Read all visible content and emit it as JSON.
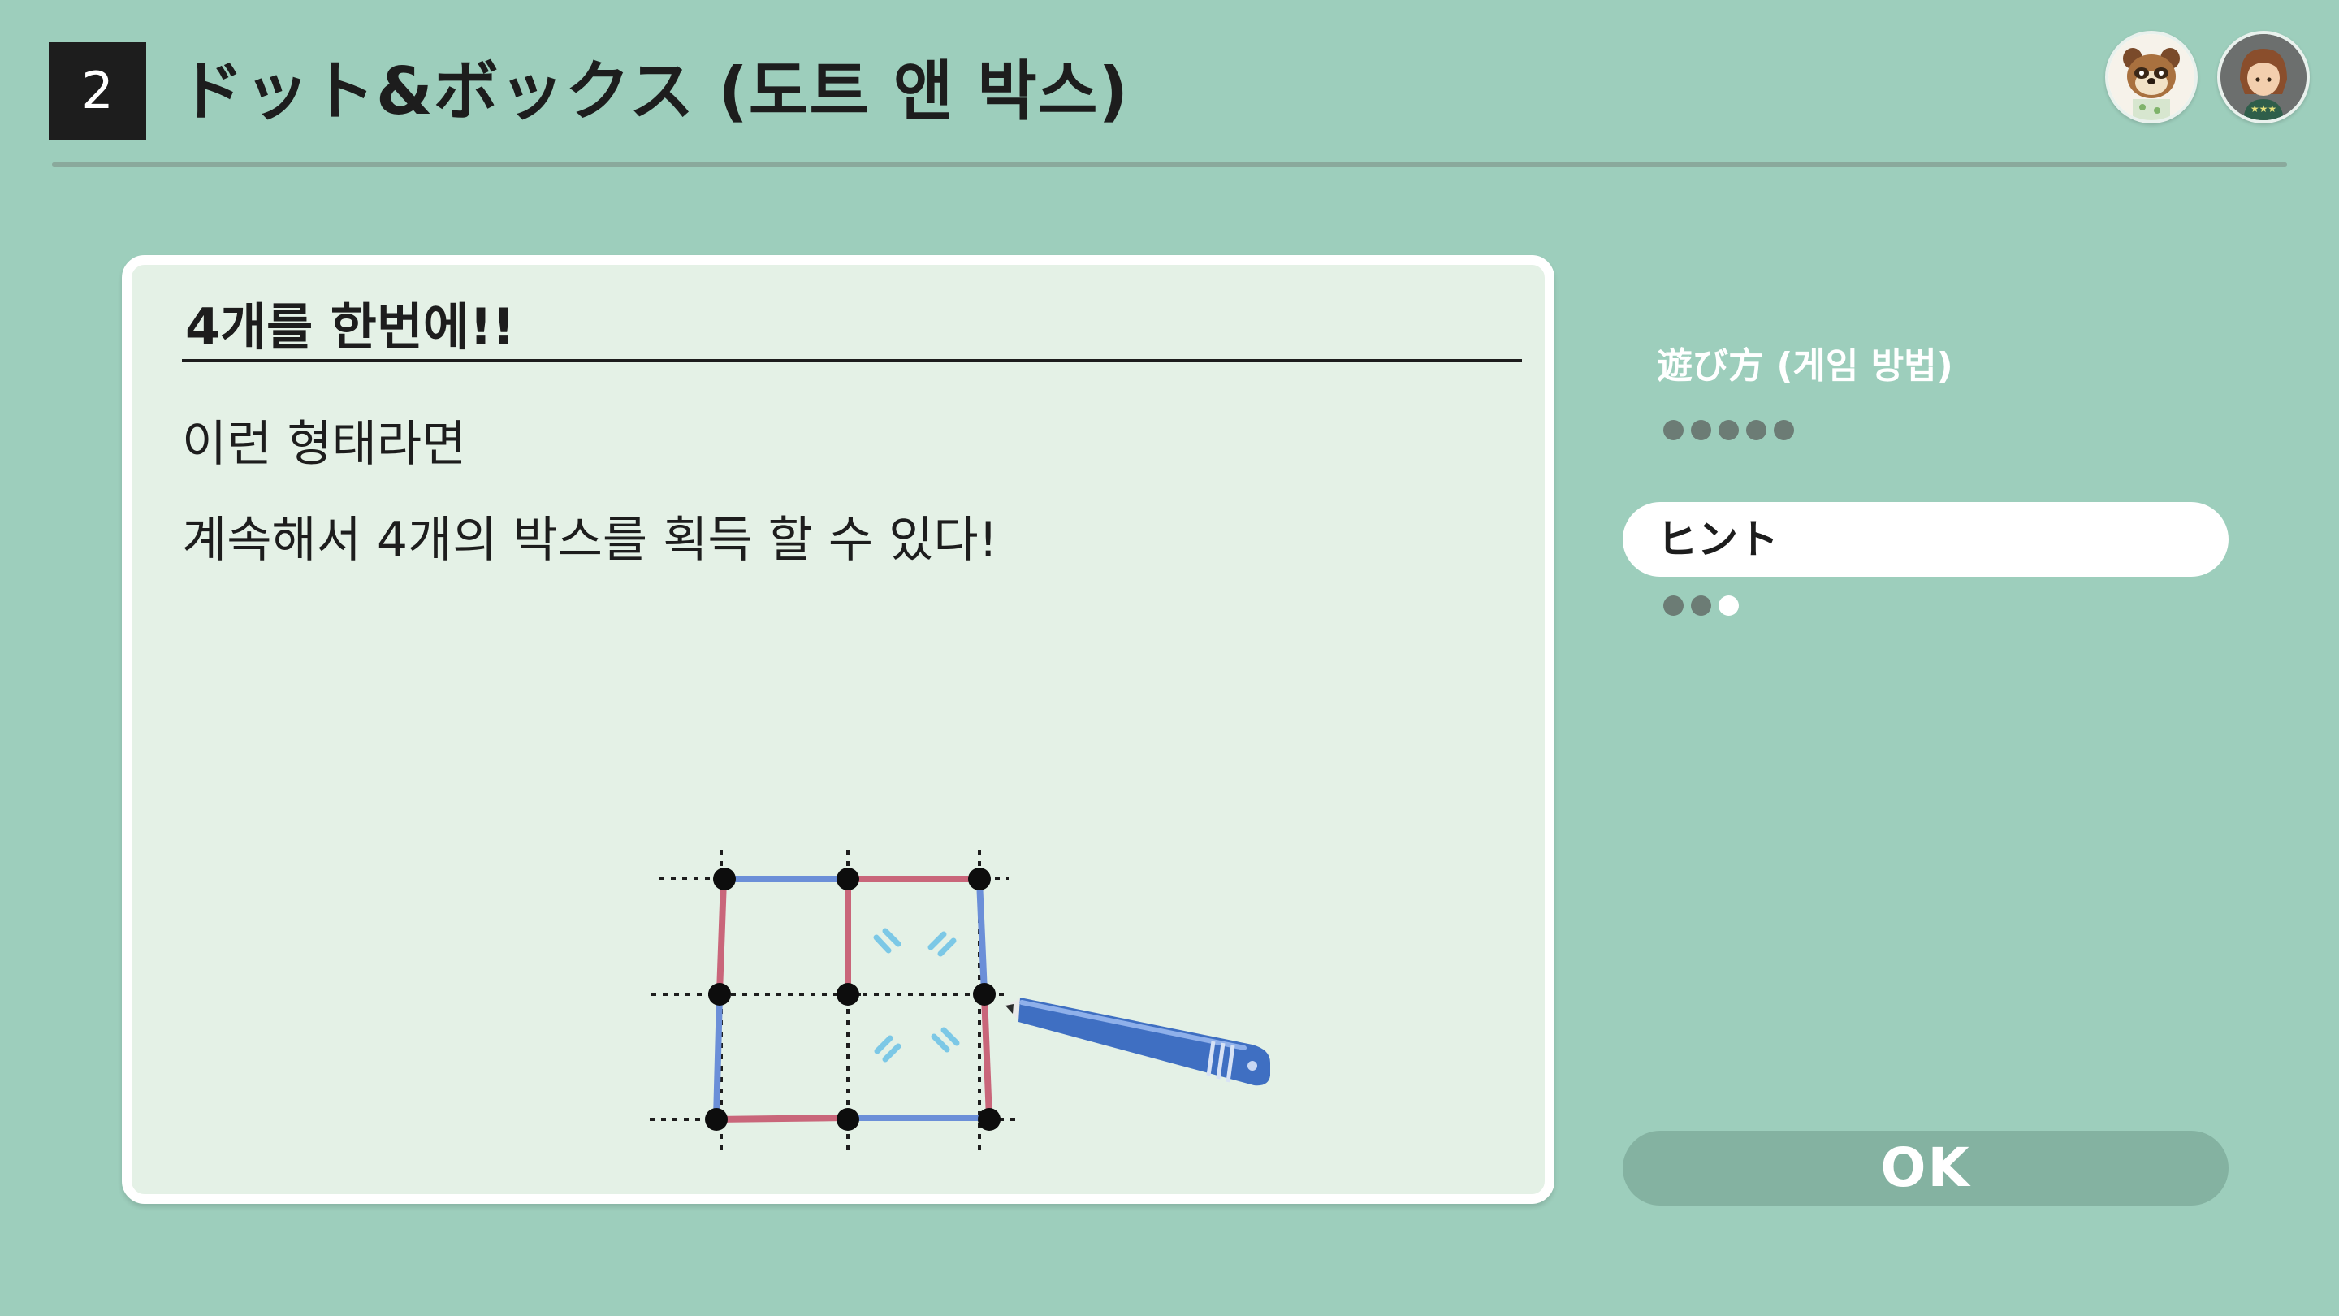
{
  "header": {
    "step_number": "2",
    "title": "ドット&ボックス (도트 앤 박스)"
  },
  "panel": {
    "heading": "4개를 한번에!!",
    "line1": "이런 형태라면",
    "line2": "계속해서 4개의 박스를 획득 할 수 있다!"
  },
  "menu": {
    "how_to_play": {
      "label": "遊び方 (게임 방법)",
      "page_count": 5,
      "current_page": null
    },
    "hint": {
      "label": "ヒント",
      "page_count": 3,
      "current_page": 3
    },
    "ok_label": "OK"
  },
  "colors": {
    "background": "#9dcebc",
    "panel": "#e4f1e6",
    "player_line_blue": "#6b8fd8",
    "player_line_red": "#c9667a",
    "highlight": "#7cc8e6",
    "pen": "#3f6fc2"
  }
}
